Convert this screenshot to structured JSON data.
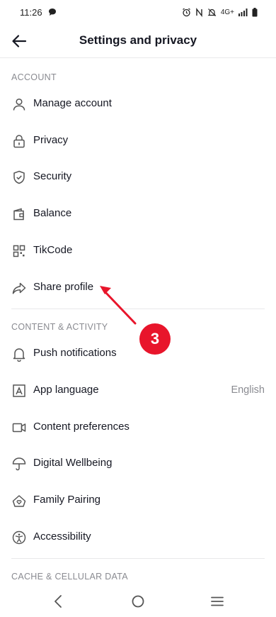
{
  "status": {
    "time": "11:26",
    "network": "4G+"
  },
  "header": {
    "title": "Settings and privacy"
  },
  "sections": {
    "account": "ACCOUNT",
    "content": "CONTENT & ACTIVITY",
    "cache": "CACHE & CELLULAR DATA"
  },
  "account_items": [
    {
      "label": "Manage account",
      "icon": "person-icon"
    },
    {
      "label": "Privacy",
      "icon": "lock-icon"
    },
    {
      "label": "Security",
      "icon": "shield-icon"
    },
    {
      "label": "Balance",
      "icon": "wallet-icon"
    },
    {
      "label": "TikCode",
      "icon": "qr-code-icon"
    },
    {
      "label": "Share profile",
      "icon": "share-icon"
    }
  ],
  "content_items": [
    {
      "label": "Push notifications",
      "icon": "bell-icon"
    },
    {
      "label": "App language",
      "icon": "language-icon",
      "value": "English"
    },
    {
      "label": "Content preferences",
      "icon": "video-icon"
    },
    {
      "label": "Digital Wellbeing",
      "icon": "umbrella-icon"
    },
    {
      "label": "Family Pairing",
      "icon": "house-heart-icon"
    },
    {
      "label": "Accessibility",
      "icon": "accessibility-icon"
    }
  ],
  "annotation": {
    "step": "3",
    "color": "#e8152b"
  },
  "colors": {
    "accent": "#e8152b",
    "muted": "#8a8b91",
    "text": "#161823"
  }
}
